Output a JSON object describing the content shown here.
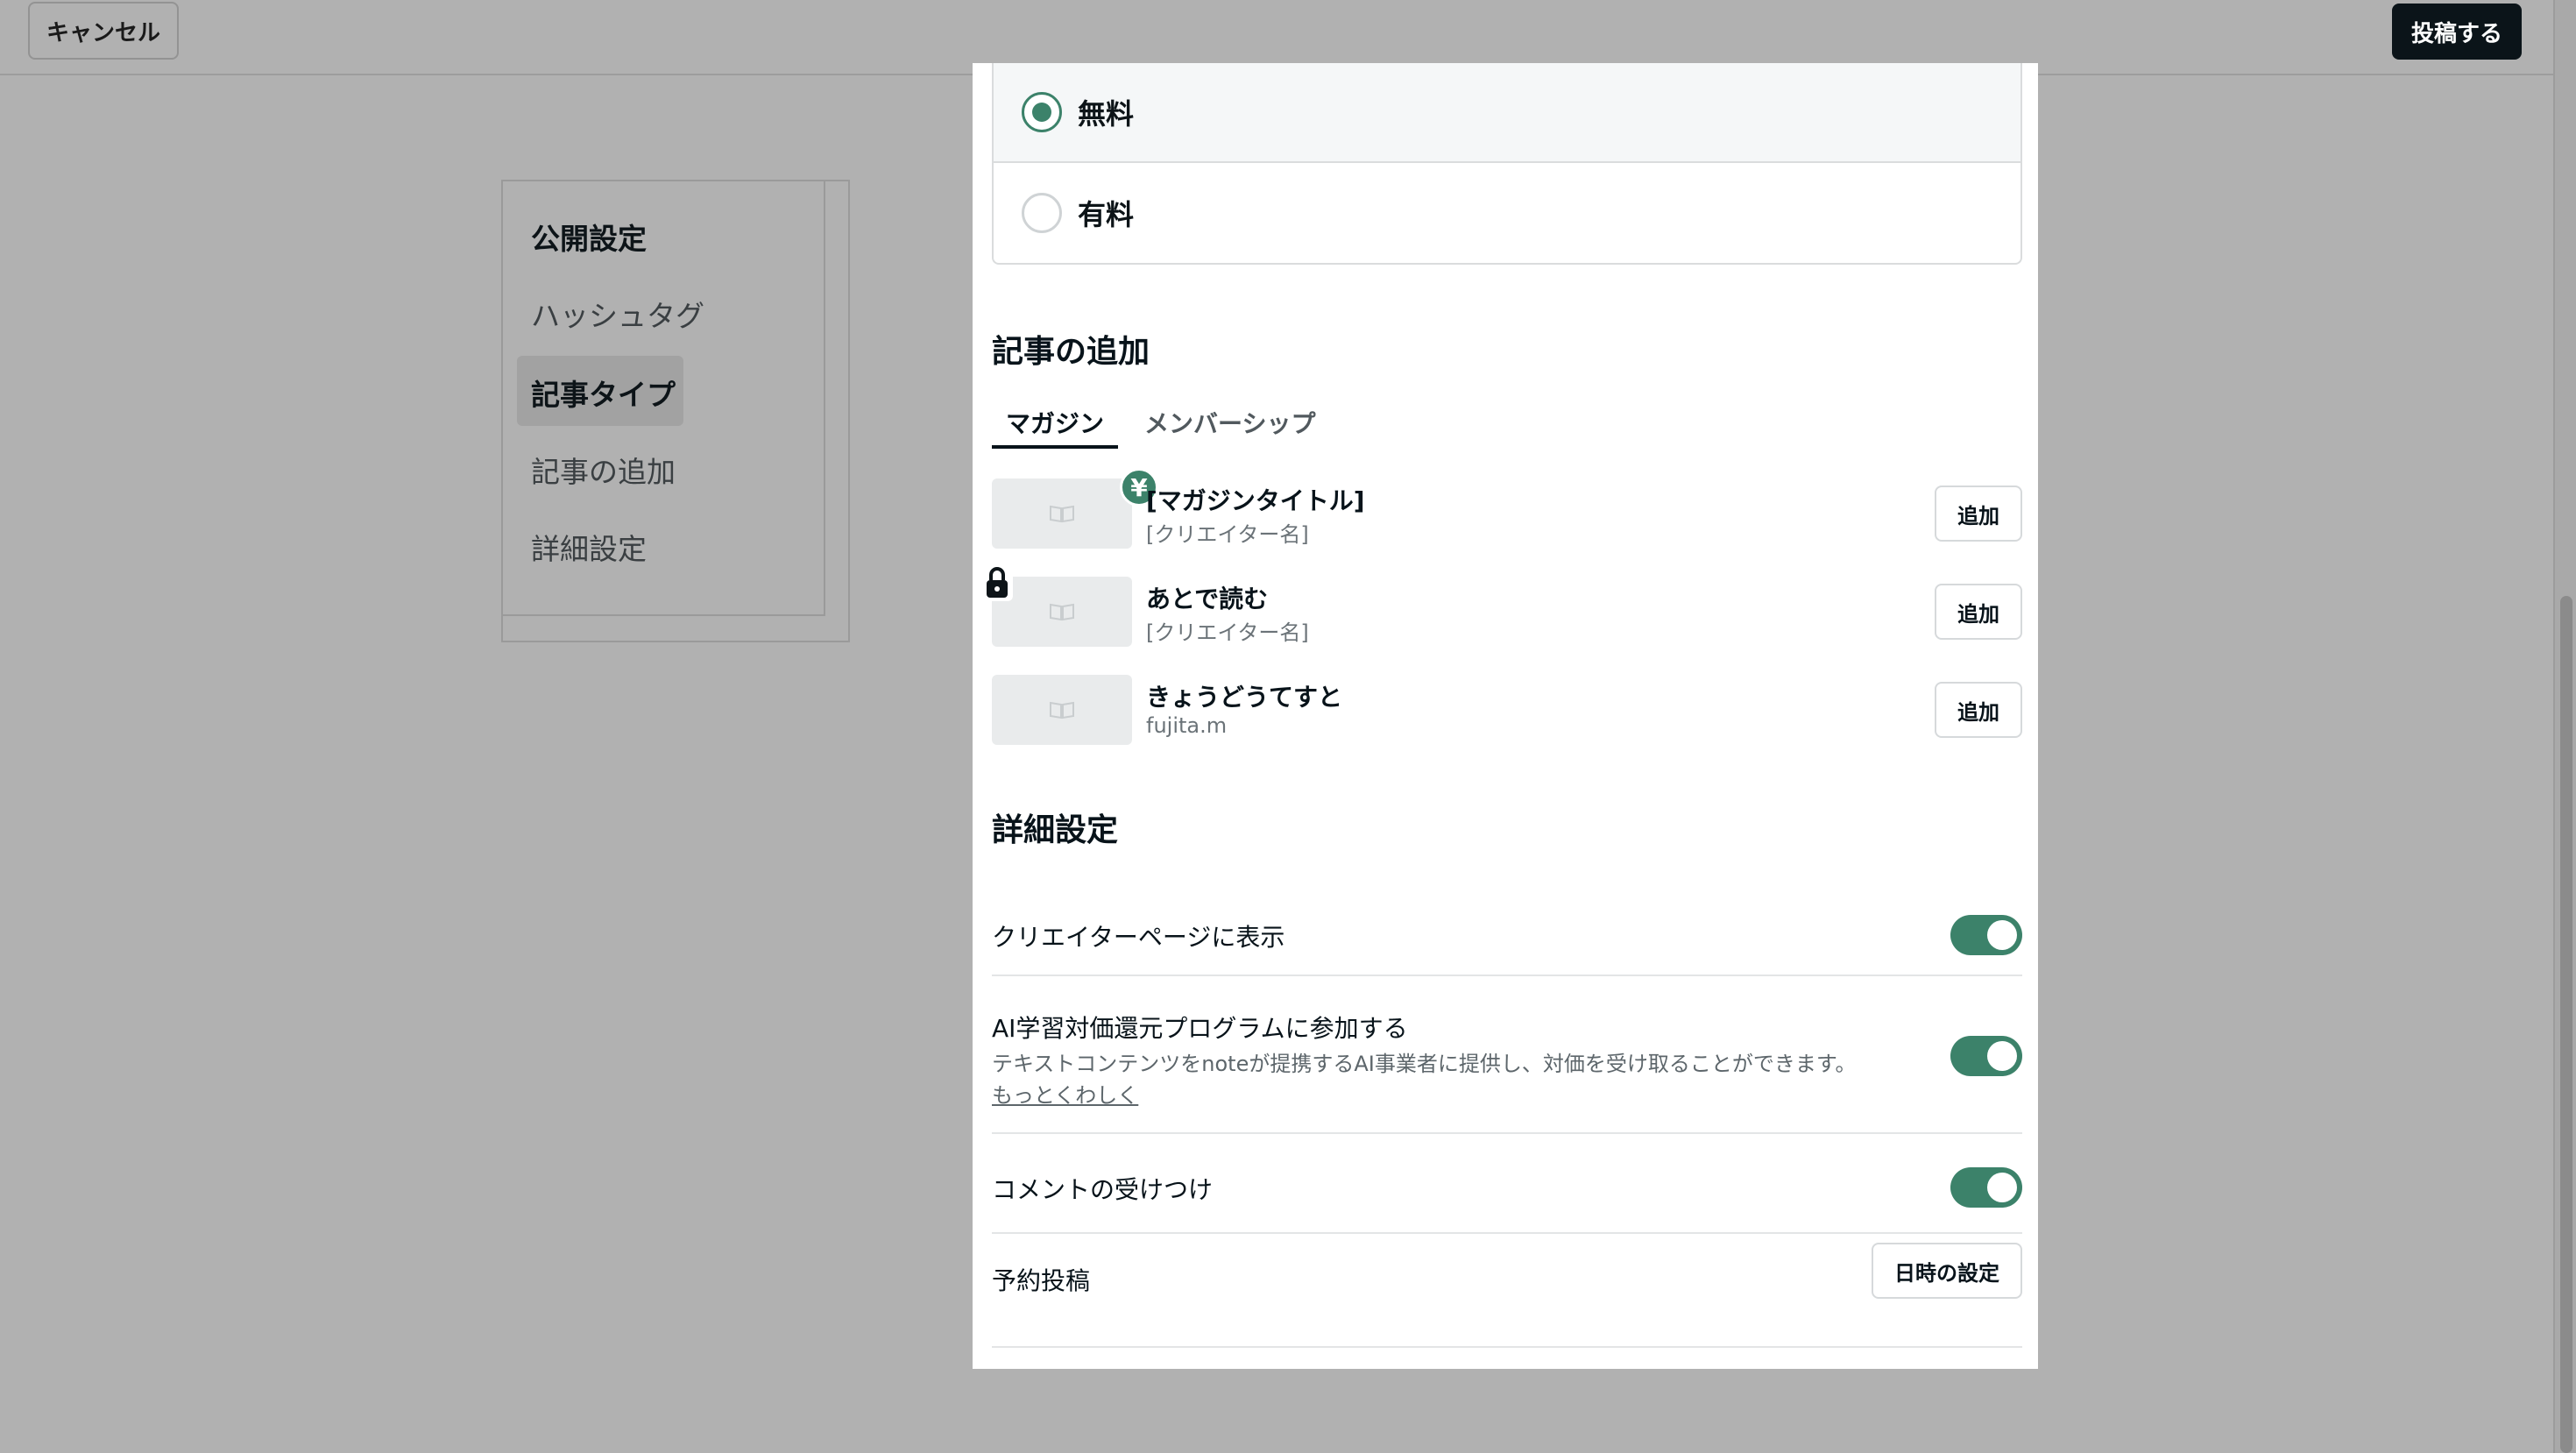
{
  "header": {
    "cancel_label": "キャンセル",
    "publish_label": "投稿する"
  },
  "sidebar": {
    "items": [
      {
        "label": "公開設定"
      },
      {
        "label": "ハッシュタグ"
      },
      {
        "label": "記事タイプ"
      },
      {
        "label": "記事の追加"
      },
      {
        "label": "詳細設定"
      }
    ],
    "active_item": "記事タイプ"
  },
  "article_type": {
    "options": [
      {
        "label": "無料",
        "selected": true
      },
      {
        "label": "有料",
        "selected": false
      }
    ]
  },
  "add_article": {
    "title": "記事の追加",
    "tabs": [
      {
        "label": "マガジン",
        "active": true
      },
      {
        "label": "メンバーシップ",
        "active": false
      }
    ],
    "magazines": [
      {
        "title": "[マガジンタイトル]",
        "creator": "[クリエイター名]",
        "button": "追加",
        "badge": "¥"
      },
      {
        "title": "あとで読む",
        "creator": "[クリエイター名]",
        "button": "追加",
        "badge_icon": "lock-icon"
      },
      {
        "title": "きょうどうてすと",
        "creator": "fujita.m",
        "button": "追加"
      }
    ]
  },
  "details": {
    "title": "詳細設定",
    "settings": [
      {
        "label": "クリエイターページに表示",
        "enabled": true
      },
      {
        "label": "AI学習対価還元プログラムに参加する",
        "description": "テキストコンテンツをnoteが提携するAI事業者に提供し、対価を受け取ることができます。",
        "link": "もっとくわしく",
        "enabled": true
      },
      {
        "label": "コメントの受けつけ",
        "enabled": true
      },
      {
        "label": "予約投稿",
        "button": "日時の設定"
      }
    ]
  },
  "colors": {
    "accent": "#3c826a",
    "overlay": "#b1b1b1",
    "primary_button": "#0b1419"
  }
}
